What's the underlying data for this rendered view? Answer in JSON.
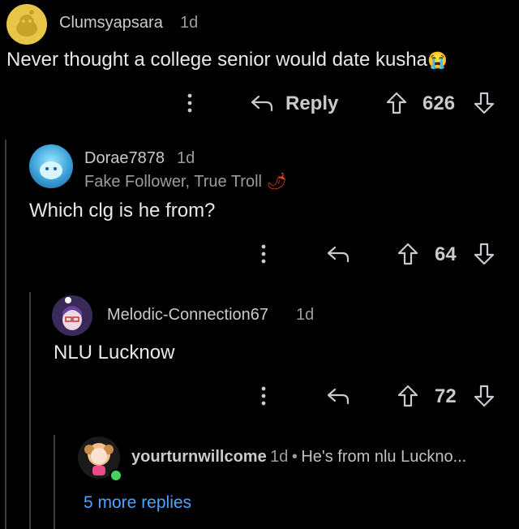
{
  "comments": [
    {
      "username": "Clumsyapsara",
      "age": "1d",
      "body": "Never thought a college senior would date kusha",
      "body_emoji": "😭",
      "reply_label": "Reply",
      "votes": "626"
    },
    {
      "username": "Dorae7878",
      "age": "1d",
      "flair": "Fake Follower, True Troll",
      "flair_emoji": "🌶",
      "body": "Which clg is he from?",
      "votes": "64"
    },
    {
      "username": "Melodic-Connection67",
      "age": "1d",
      "body": "NLU Lucknow",
      "votes": "72"
    },
    {
      "username": "yourturnwillcome",
      "age": "1d",
      "separator": "•",
      "preview": "He's from nlu Luckno..."
    }
  ],
  "more_replies": "5 more replies",
  "colors": {
    "background": "#000000",
    "link": "#4fa3ff",
    "online": "#46d160"
  },
  "icons": [
    "snoo-avatar-icon",
    "more-options-icon",
    "reply-arrow-icon",
    "upvote-icon",
    "downvote-icon",
    "online-dot-icon"
  ]
}
